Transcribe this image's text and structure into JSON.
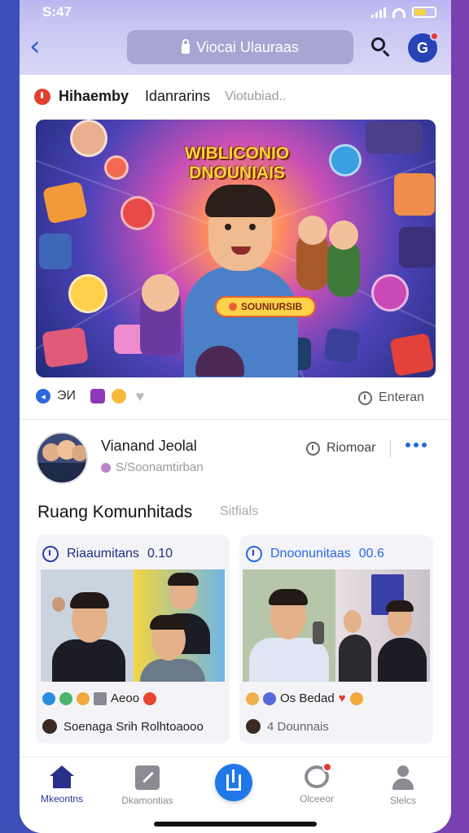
{
  "status_bar": {
    "time": "S:47"
  },
  "header": {
    "title": "Viocai Ulauraas"
  },
  "post": {
    "user": "Hihaemby",
    "name": "Idanrarins",
    "meta": "Viotubiad..",
    "banner_title": "WIBLICONIO DNOUNIAIS",
    "banner_cta": "SOUNIURSIB",
    "reaction_count": "ЭИ",
    "comment_label": "Enteran"
  },
  "group": {
    "name": "Vianand Jeolal",
    "subtitle": "S/Soonamtirban",
    "member_label": "Riomoar"
  },
  "section": {
    "title": "Ruang Komunhitads",
    "link": "Sitfials"
  },
  "cards": [
    {
      "title": "Riaaumitans",
      "count": "0.10",
      "reaction_text": "Aeoo",
      "footer": "Soenaga Srih Rolhtoaooo"
    },
    {
      "title": "Dnoonunitaas",
      "count": "00.6",
      "reaction_text": "Os Bedad",
      "footer": "4 Dounnais"
    }
  ],
  "nav": [
    {
      "label": "Mkeontns",
      "icon": "home-icon"
    },
    {
      "label": "Dkamontias",
      "icon": "square-icon"
    },
    {
      "label": "",
      "icon": "create-icon"
    },
    {
      "label": "Olceeor",
      "icon": "chat-icon"
    },
    {
      "label": "Slelcs",
      "icon": "person-icon"
    }
  ],
  "colors": {
    "accent": "#2a68e0",
    "primary_nav": "#2a2f8a",
    "live_red": "#e0402f"
  }
}
